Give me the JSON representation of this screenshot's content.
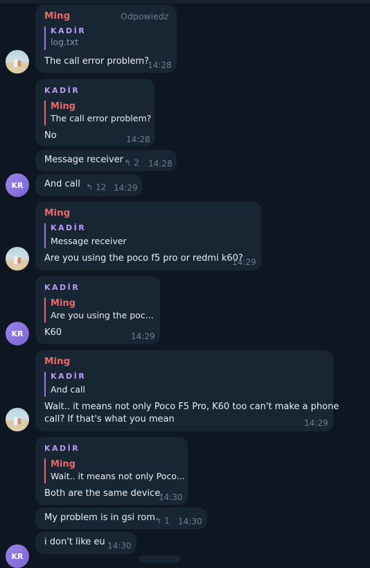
{
  "labels": {
    "reply_action": "Odpowiedz"
  },
  "messages": [
    {
      "sender": "Ming",
      "quote_name": "KADİR",
      "quote_text": "log.txt",
      "text": "The call error problem?",
      "time": "14:28"
    },
    {
      "quote_name": "KADİR",
      "quote2_name": "Ming",
      "quote_text": "The call error problem?",
      "text": "No",
      "time": "14:28"
    },
    {
      "text": "Message receiver",
      "reply_count": "2",
      "time": "14:28"
    },
    {
      "avatar": "KR",
      "text": "And call",
      "reply_count": "12",
      "time": "14:29"
    },
    {
      "sender": "Ming",
      "quote_name": "KADİR",
      "quote_text": "Message receiver",
      "text": "Are you using the poco f5 pro or redmi k60?",
      "time": "14:29"
    },
    {
      "quote_name": "KADİR",
      "quote2_name": "Ming",
      "quote_text": "Are you using the poc...",
      "text": "K60",
      "time": "14:29"
    },
    {
      "sender": "Ming",
      "quote_name": "KADİR",
      "quote_text": "And call",
      "text_line1": "Wait.. it means not only Poco F5 Pro, K60 too can't make a phone",
      "text_line2": "call? If that's what you mean",
      "time": "14:29"
    },
    {
      "quote_name": "KADİR",
      "quote2_name": "Ming",
      "quote_text": "Wait.. it means not only Poco...",
      "text": "Both are the same device.",
      "time": "14:30"
    },
    {
      "text": "My problem is in gsi rom",
      "reply_count": "1",
      "time": "14:30"
    },
    {
      "avatar": "KR",
      "text": "i don't like eu",
      "time": "14:30"
    }
  ],
  "icons": {
    "reply_arrow": "↰"
  }
}
